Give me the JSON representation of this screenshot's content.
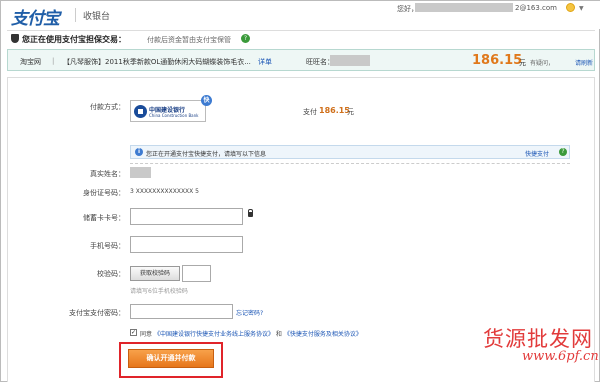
{
  "header": {
    "logo": "支付宝",
    "subtitle": "收银台",
    "greeting": "您好，",
    "email_suffix": "2@163.com"
  },
  "guarantee": {
    "title": "您正在使用支付宝担保交易：",
    "description": "付款后资金暂由支付宝保管",
    "help": "?"
  },
  "order": {
    "site": "淘宝网",
    "separator": "|",
    "title": "【凡琴服饰】2011秋季新款OL通勤休闲大码蝴蝶装饰毛衣...",
    "detail_link": "详单",
    "seller_label": "旺旺名：",
    "amount": "186.15",
    "unit": "元",
    "question": "有疑问，请刷新",
    "refresh_link": "请刷新"
  },
  "payment": {
    "method_label": "付款方式：",
    "bank_name": "中国建设银行",
    "bank_name_en": "China Construction Bank",
    "quick_badge": "快",
    "pay_label": "支付",
    "pay_amount": "186.15",
    "pay_unit": "元"
  },
  "info": {
    "icon": "i",
    "text": "您正在开通支付宝快捷支付，请填写以下信息",
    "link": "快捷支付",
    "help": "?"
  },
  "form": {
    "real_name_label": "真实姓名：",
    "id_label": "身份证号码：",
    "id_value": "3 XXXXXXXXXXXXXX 5",
    "card_label": "储蓄卡卡号：",
    "phone_label": "手机号码：",
    "code_label": "校验码：",
    "code_button": "获取校验码",
    "code_hint": "请填写6位手机校验码",
    "password_label": "支付宝支付密码：",
    "forgot_link": "忘记密码?",
    "agree_check": "✓",
    "agree_prefix": "同意",
    "agree_link1": "《中国建设银行快捷支付业务线上服务协议》",
    "agree_and": "和",
    "agree_link2": "《快捷支付服务及相关协议》",
    "confirm_button": "确认开通并付款"
  },
  "watermark": {
    "cn": "货源批发网",
    "url": "www.6pf.cn"
  },
  "colors": {
    "brand_blue": "#1f5ea8",
    "amount_orange": "#e0781a",
    "confirm_orange": "#e6761b",
    "highlight_red": "#e0242a"
  }
}
